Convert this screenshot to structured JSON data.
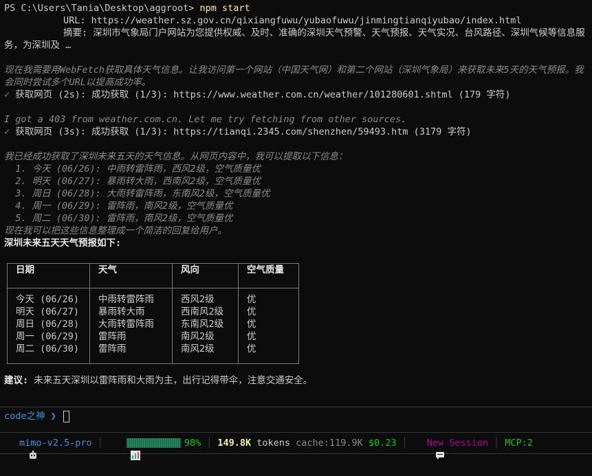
{
  "terminal": {
    "prompt_path": "PS C:\\Users\\Tania\\Desktop\\aggroot> ",
    "command": "npm start",
    "url_label": "URL: ",
    "url_value": "https://weather.sz.gov.cn/qixiangfuwu/yubaofuwu/jinmingtianqiyubao/index.html",
    "summary_label": "摘要: ",
    "summary_value": "深圳市气象局门户网站为您提供权威、及时、准确的深圳天气预警、天气预报、天气实况、台风路径、深圳气候等信息服务，为深圳及 …",
    "thought_1": "现在我需要用WebFetch获取具体天气信息。让我访问第一个网站（中国天气网）和第二个网站（深圳气象局）来获取未来5天的天气预报。我会同时尝试多个URL以提高成功率。",
    "fetch_1": "获取网页 (2s): 成功获取 (1/3): https://www.weather.com.cn/weather/101280601.shtml (179 字符)",
    "note_403": "I got a 403 from weather.com.cn. Let me try fetching from other sources.",
    "fetch_2": "获取网页 (3s): 成功获取 (1/3): https://tianqi.2345.com/shenzhen/59493.htm (3179 字符)",
    "thought_2_intro": "我已经成功获取了深圳未来五天的天气信息。从网页内容中，我可以提取以下信息：",
    "thought_2_items": [
      "  1. 今天 (06/26): 中雨转雷阵雨，西风2级，空气质量优",
      "  2. 明天 (06/27): 暴雨转大雨，西南风2级，空气质量优",
      "  3. 周日 (06/28): 大雨转雷阵雨，东南风2级，空气质量优",
      "  4. 周一 (06/29): 雷阵雨，南风2级，空气质量优",
      "  5. 周二 (06/30): 雷阵雨，南风2级，空气质量优"
    ],
    "thought_2_outro": "现在我可以把这些信息整理成一个简洁的回复给用户。",
    "answer_heading": "深圳未来五天天气预报如下:",
    "table": {
      "headers": [
        "日期",
        "天气",
        "风向",
        "空气质量"
      ],
      "rows": [
        [
          "今天 (06/26)",
          "中雨转雷阵雨",
          "西风2级",
          "优"
        ],
        [
          "明天 (06/27)",
          "暴雨转大雨",
          "西南风2级",
          "优"
        ],
        [
          "周日 (06/28)",
          "大雨转雷阵雨",
          "东南风2级",
          "优"
        ],
        [
          "周一 (06/29)",
          "雷阵雨",
          "南风2级",
          "优"
        ],
        [
          "周二 (06/30)",
          "雷阵雨",
          "南风2级",
          "优"
        ]
      ]
    },
    "advice_label": "建议:",
    "advice_text": " 未来五天深圳以雷阵雨和大雨为主，出行记得带伞，注意交通安全。",
    "check_mark": "✓"
  },
  "input": {
    "prompt_label": "code之神 ❯ "
  },
  "status_bar": {
    "model": "mimo-v2.5-pro",
    "context_percent": "98%",
    "context_fraction": 0.98,
    "tokens_value": "149.8K",
    "tokens_label": " tokens",
    "cache": "cache:119.9K",
    "cost": "$0.23",
    "new_session": "New Session",
    "mcp": "MCP:2",
    "icons": {
      "model": "robot-icon",
      "context": "bar-chart-icon",
      "session": "chat-icon"
    },
    "colors": {
      "model": "#3a96dd",
      "ok": "#16c60c",
      "tokens": "#f9f1a5",
      "new_session": "#b4009e"
    }
  }
}
